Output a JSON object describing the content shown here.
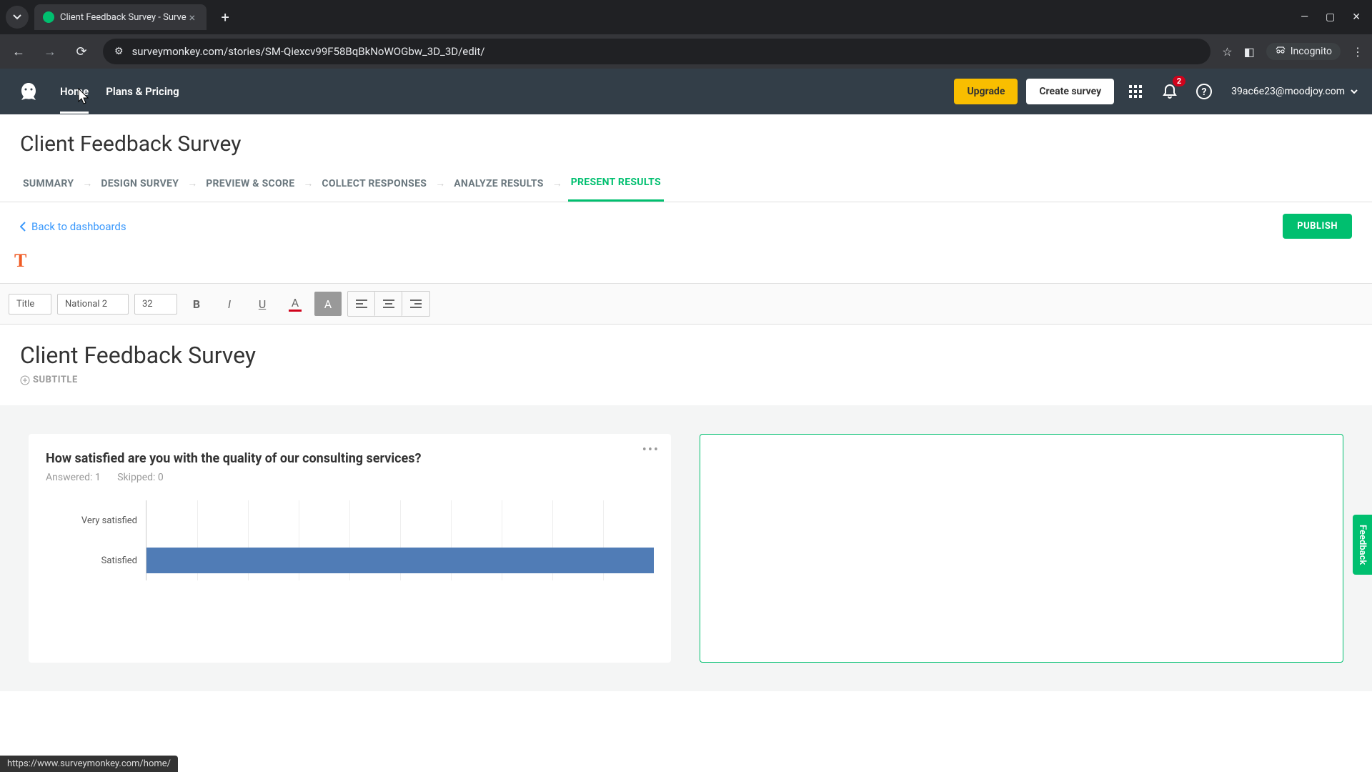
{
  "browser": {
    "tab_title": "Client Feedback Survey - Surve",
    "url": "surveymonkey.com/stories/SM-Qiexcv99F58BqBkNoWOGbw_3D_3D/edit/",
    "incognito_label": "Incognito"
  },
  "header": {
    "nav": {
      "home": "Home",
      "plans": "Plans & Pricing"
    },
    "upgrade": "Upgrade",
    "create": "Create survey",
    "notification_count": "2",
    "user_email": "39ac6e23@moodjoy.com"
  },
  "page": {
    "title": "Client Feedback Survey"
  },
  "workflow": {
    "tabs": [
      "SUMMARY",
      "DESIGN SURVEY",
      "PREVIEW & SCORE",
      "COLLECT RESPONSES",
      "ANALYZE RESULTS",
      "PRESENT RESULTS"
    ],
    "active_index": 5
  },
  "subheader": {
    "back": "Back to dashboards",
    "publish": "PUBLISH"
  },
  "toolbar": {
    "style": "Title",
    "font": "National 2",
    "size": "32"
  },
  "editor": {
    "title": "Client Feedback Survey",
    "subtitle_label": "SUBTITLE"
  },
  "question": {
    "text": "How satisfied are you with the quality of our consulting services?",
    "answered_label": "Answered: 1",
    "skipped_label": "Skipped: 0"
  },
  "chart_data": {
    "type": "bar",
    "orientation": "horizontal",
    "categories": [
      "Very satisfied",
      "Satisfied"
    ],
    "values": [
      0,
      100
    ],
    "xlabel": "",
    "ylabel": "",
    "ylim": [
      0,
      100
    ]
  },
  "feedback_tab": "Feedback",
  "status_url": "https://www.surveymonkey.com/home/"
}
